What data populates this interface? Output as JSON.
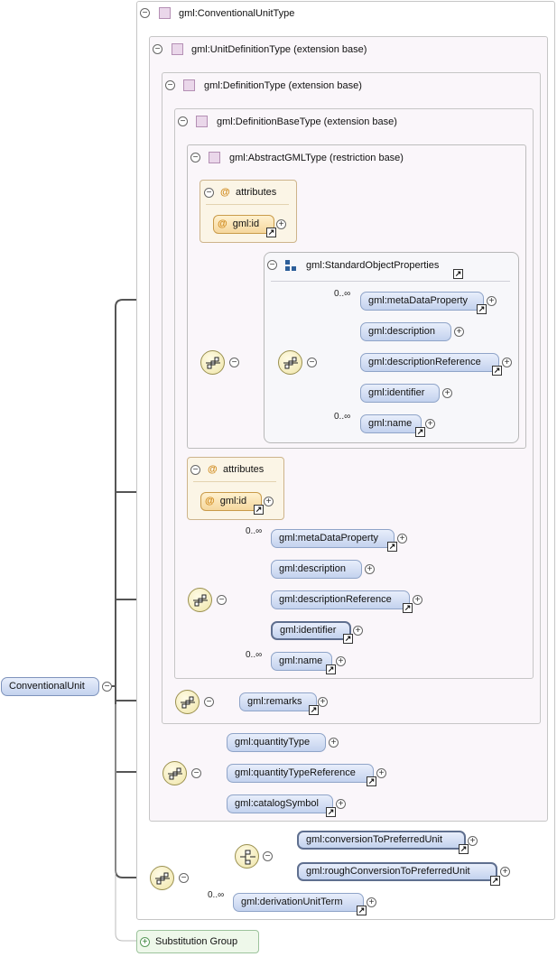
{
  "root": {
    "label": "ConventionalUnit"
  },
  "types": {
    "conventional_unit_type": "gml:ConventionalUnitType",
    "unit_definition_type": "gml:UnitDefinitionType (extension base)",
    "definition_type": "gml:DefinitionType (extension base)",
    "definition_base_type": "gml:DefinitionBaseType (extension base)",
    "abstract_gml_type": "gml:AbstractGMLType (restriction base)"
  },
  "group": {
    "label": "gml:StandardObjectProperties"
  },
  "attributes": {
    "label": "attributes",
    "id_label": "gml:id"
  },
  "cardinality": {
    "zero_to_many": "0..∞"
  },
  "elements": {
    "meta_data_property": "gml:metaDataProperty",
    "description": "gml:description",
    "description_reference": "gml:descriptionReference",
    "identifier": "gml:identifier",
    "name": "gml:name",
    "remarks": "gml:remarks",
    "quantity_type": "gml:quantityType",
    "quantity_type_reference": "gml:quantityTypeReference",
    "catalog_symbol": "gml:catalogSymbol",
    "conversion_to_preferred_unit": "gml:conversionToPreferredUnit",
    "rough_conversion_to_preferred_unit": "gml:roughConversionToPreferredUnit",
    "derivation_unit_term": "gml:derivationUnitTerm"
  },
  "substitution_group": {
    "label": "Substitution Group"
  },
  "glyphs": {
    "collapse": "−",
    "expand": "+",
    "link": "↗",
    "at": "@"
  }
}
